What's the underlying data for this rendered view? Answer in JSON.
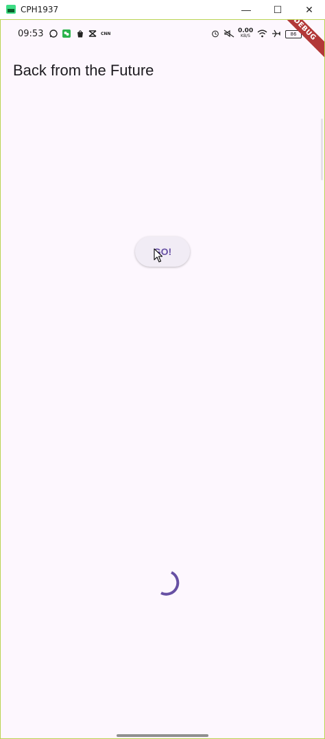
{
  "window": {
    "title": "CPH1937",
    "controls": {
      "minimize": "—",
      "maximize": "☐",
      "close": "✕"
    }
  },
  "status_bar": {
    "time": "09:53",
    "net_speed_value": "0.00",
    "net_speed_unit": "KB/S",
    "battery": "86"
  },
  "debug_banner": "DEBUG",
  "app_bar": {
    "title": "Back from the Future"
  },
  "main": {
    "button_label": "GO!"
  },
  "colors": {
    "background": "#fdf7fe",
    "primary": "#6750a4",
    "button_bg": "#f1ecf5",
    "frame_border": "#b9d451"
  },
  "icons": [
    "app-icon",
    "whatsapp-icon",
    "wechat-icon",
    "shopee-icon",
    "capcut-icon",
    "cnn-icon",
    "alarm-icon",
    "mute-icon",
    "wifi-icon",
    "airplane-icon",
    "battery-icon",
    "loading-spinner"
  ]
}
